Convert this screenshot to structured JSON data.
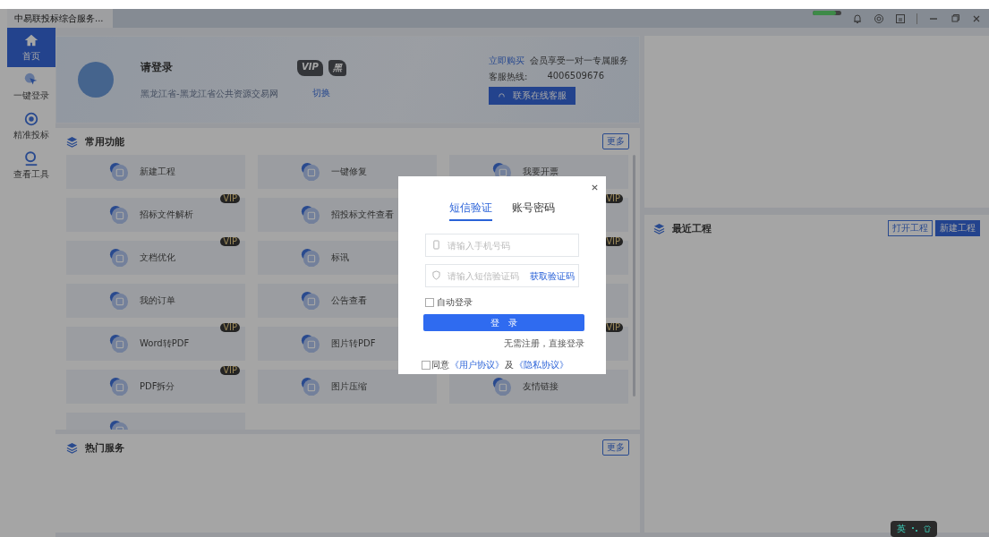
{
  "window": {
    "title": "中易联投标综合服务..."
  },
  "progress": {
    "level": 0.8
  },
  "sidebar": {
    "items": [
      {
        "label": "首页",
        "selected": true,
        "kind": "home"
      },
      {
        "label": "一键登录",
        "selected": false,
        "kind": "pointer"
      },
      {
        "label": "精准投标",
        "selected": false,
        "kind": "target"
      },
      {
        "label": "查看工具",
        "selected": false,
        "kind": "search"
      }
    ]
  },
  "profile": {
    "name": "请登录",
    "location": "黑龙江省-黑龙江省公共资源交易网",
    "switch": "切换",
    "vip_badge": "VIP",
    "black_badge": "黑"
  },
  "promo": {
    "link": "立即购买",
    "text": "会员享受一对一专属服务",
    "hotline_label": "客服热线:",
    "hotline": "4006509676",
    "button": "联系在线客服"
  },
  "common": {
    "title": "常用功能",
    "more": "更多",
    "tiles": [
      {
        "label": "新建工程",
        "vip": false
      },
      {
        "label": "一键修复",
        "vip": false
      },
      {
        "label": "我要开票",
        "vip": false
      },
      {
        "label": "招标文件解析",
        "vip": true,
        "vip_label": "VIP"
      },
      {
        "label": "招投标文件查看",
        "vip": false
      },
      {
        "vip": true,
        "vip_label": "VIP"
      },
      {
        "label": "文档优化",
        "vip": true,
        "vip_label": "VIP"
      },
      {
        "label": "标讯",
        "vip": false
      },
      {
        "vip": true,
        "vip_label": "VIP"
      },
      {
        "label": "我的订单",
        "vip": false
      },
      {
        "label": "公告查看",
        "vip": false
      },
      {
        "vip": false
      },
      {
        "label": "Word转PDF",
        "vip": true,
        "vip_label": "VIP"
      },
      {
        "label": "图片转PDF",
        "vip": false
      },
      {
        "vip": true,
        "vip_label": "VIP"
      },
      {
        "label": "PDF拆分",
        "vip": true,
        "vip_label": "VIP"
      },
      {
        "label": "图片压缩",
        "vip": false
      },
      {
        "label": "友情链接",
        "vip": false
      },
      {
        "vip": false
      }
    ]
  },
  "hot": {
    "title": "热门服务",
    "more": "更多"
  },
  "recent": {
    "title": "最近工程",
    "open": "打开工程",
    "new": "新建工程"
  },
  "login": {
    "tabs": [
      {
        "label": "短信验证",
        "selected": true
      },
      {
        "label": "账号密码",
        "selected": false
      }
    ],
    "phone_placeholder": "请输入手机号码",
    "code_placeholder": "请输入短信验证码",
    "get_code": "获取验证码",
    "auto_login": {
      "label": "自动登录",
      "checked": false
    },
    "button": "登　录",
    "note": "无需注册，直接登录",
    "agree": {
      "checked": false,
      "prefix": "同意",
      "user_link": "《用户协议》",
      "mid": "及",
      "privacy_link": "《隐私协议》"
    }
  },
  "ime": {
    "label": "英"
  }
}
